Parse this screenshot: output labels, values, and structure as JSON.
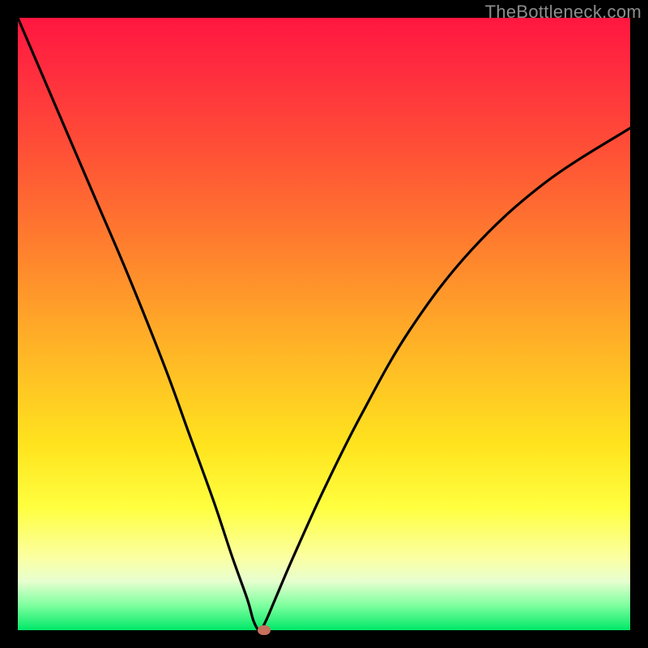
{
  "watermark": "TheBottleneck.com",
  "chart_data": {
    "type": "line",
    "title": "",
    "xlabel": "",
    "ylabel": "",
    "xlim": [
      0,
      100
    ],
    "ylim": [
      0,
      100
    ],
    "series": [
      {
        "name": "bottleneck-curve",
        "x": [
          0,
          6,
          12,
          18,
          24,
          28,
          32,
          35,
          37.5,
          38.5,
          39.5,
          40.5,
          42,
          45,
          50,
          56,
          64,
          74,
          86,
          100
        ],
        "values": [
          100,
          86,
          72,
          58,
          43,
          32,
          21,
          12,
          5,
          1.5,
          0,
          1.5,
          5,
          12,
          23,
          35,
          49,
          62,
          73,
          82
        ]
      }
    ],
    "marker": {
      "x": 40.2,
      "y": 0
    },
    "gradient_stops": [
      {
        "pos": 0,
        "color": "#ff163f"
      },
      {
        "pos": 22,
        "color": "#ff5136"
      },
      {
        "pos": 55,
        "color": "#ffb726"
      },
      {
        "pos": 80,
        "color": "#ffff40"
      },
      {
        "pos": 100,
        "color": "#00e868"
      }
    ]
  }
}
